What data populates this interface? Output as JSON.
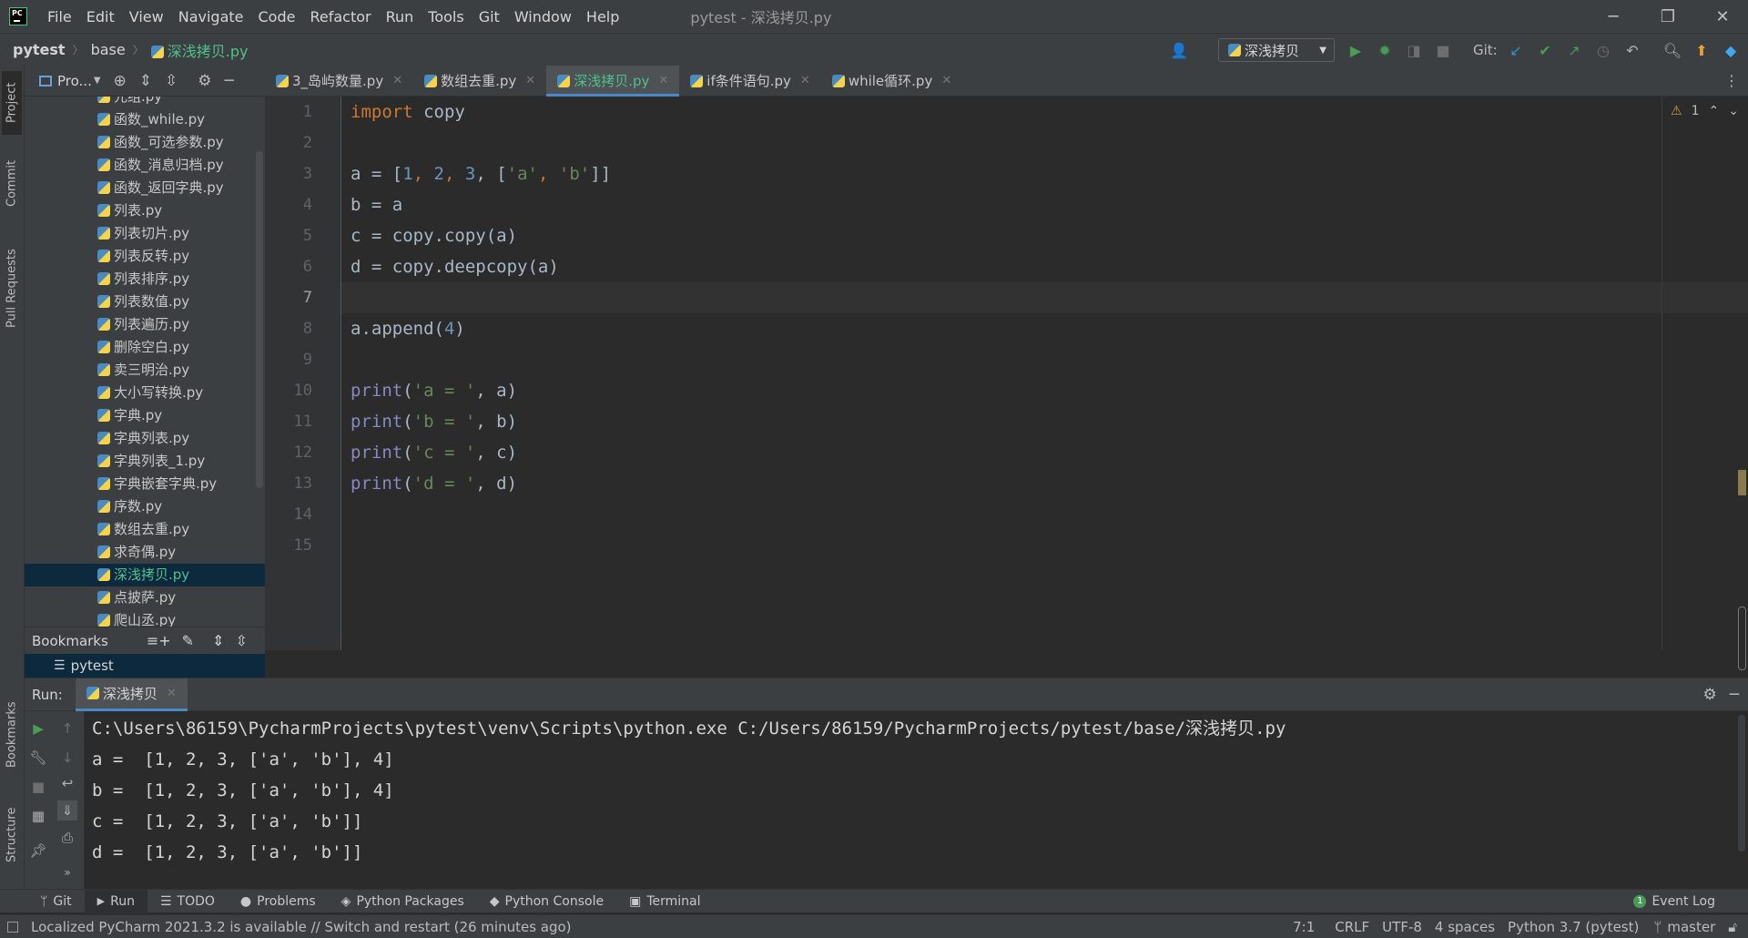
{
  "window": {
    "title": "pytest - 深浅拷贝.py",
    "menu": [
      "File",
      "Edit",
      "View",
      "Navigate",
      "Code",
      "Refactor",
      "Run",
      "Tools",
      "Git",
      "Window",
      "Help"
    ],
    "controls": {
      "minimize": "─",
      "restore": "❐",
      "close": "✕"
    }
  },
  "navbar": {
    "breadcrumb": [
      "pytest",
      "base",
      "深浅拷贝.py"
    ],
    "run_config": "深浅拷贝",
    "git_label": "Git:"
  },
  "left_strip": [
    "Project",
    "Commit",
    "Pull Requests",
    "Bookmarks",
    "Structure"
  ],
  "project": {
    "view_label": "Pro...",
    "files": [
      "元组.py",
      "函数_while.py",
      "函数_可选参数.py",
      "函数_消息归档.py",
      "函数_返回字典.py",
      "列表.py",
      "列表切片.py",
      "列表反转.py",
      "列表排序.py",
      "列表数值.py",
      "列表遍历.py",
      "删除空白.py",
      "卖三明治.py",
      "大小写转换.py",
      "字典.py",
      "字典列表.py",
      "字典列表_1.py",
      "字典嵌套字典.py",
      "序数.py",
      "数组去重.py",
      "求奇偶.py",
      "深浅拷贝.py",
      "点披萨.py",
      "爬山丞.py"
    ],
    "selected_file": "深浅拷贝.py",
    "bookmarks_title": "Bookmarks",
    "bookmarks_item": "pytest"
  },
  "editor": {
    "tabs": [
      {
        "label": "3_岛屿数量.py",
        "active": false
      },
      {
        "label": "数组去重.py",
        "active": false
      },
      {
        "label": "深浅拷贝.py",
        "active": true
      },
      {
        "label": "if条件语句.py",
        "active": false
      },
      {
        "label": "while循环.py",
        "active": false
      }
    ],
    "line_numbers": [
      "1",
      "2",
      "3",
      "4",
      "5",
      "6",
      "7",
      "8",
      "9",
      "10",
      "11",
      "12",
      "13",
      "14",
      "15"
    ],
    "current_line": "7",
    "warnings": "1",
    "code": {
      "l1_kw": "import",
      "l1_rest": " copy",
      "l3_a": "a = [",
      "l3_n1": "1",
      "l3_c1": ", ",
      "l3_n2": "2",
      "l3_c2": ", ",
      "l3_n3": "3",
      "l3_c3": ", [",
      "l3_s1": "'a'",
      "l3_c4": ", ",
      "l3_s2": "'b'",
      "l3_end": "]]",
      "l4": "b = a",
      "l5": "c = copy.copy(a)",
      "l6": "d = copy.deepcopy(a)",
      "l8_a": "a.append(",
      "l8_n": "4",
      "l8_end": ")",
      "l10_fn": "print",
      "l10_p": "(",
      "l10_s": "'a = '",
      "l10_end": ", a)",
      "l11_fn": "print",
      "l11_p": "(",
      "l11_s": "'b = '",
      "l11_end": ", b)",
      "l12_fn": "print",
      "l12_p": "(",
      "l12_s": "'c = '",
      "l12_end": ", c)",
      "l13_fn": "print",
      "l13_p": "(",
      "l13_s": "'d = '",
      "l13_end": ", d)"
    }
  },
  "run": {
    "label": "Run:",
    "tab": "深浅拷贝",
    "output": [
      "C:\\Users\\86159\\PycharmProjects\\pytest\\venv\\Scripts\\python.exe C:/Users/86159/PycharmProjects/pytest/base/深浅拷贝.py",
      "a =  [1, 2, 3, ['a', 'b'], 4]",
      "b =  [1, 2, 3, ['a', 'b'], 4]",
      "c =  [1, 2, 3, ['a', 'b']]",
      "d =  [1, 2, 3, ['a', 'b']]"
    ]
  },
  "bottom_tabs": [
    "Git",
    "Run",
    "TODO",
    "Problems",
    "Python Packages",
    "Python Console",
    "Terminal"
  ],
  "event_log": {
    "count": "1",
    "label": "Event Log"
  },
  "status": {
    "message": "Localized PyCharm 2021.3.2 is available // Switch and restart (26 minutes ago)",
    "position": "7:1",
    "line_sep": "CRLF",
    "encoding": "UTF-8",
    "indent": "4 spaces",
    "interpreter": "Python 3.7 (pytest)",
    "branch": "master"
  },
  "colors": {
    "accent_green": "#4fc08d",
    "keyword": "#cc7832",
    "number": "#6897bb",
    "string": "#6a8759",
    "builtin": "#8888c6",
    "selection": "#0d293e"
  }
}
